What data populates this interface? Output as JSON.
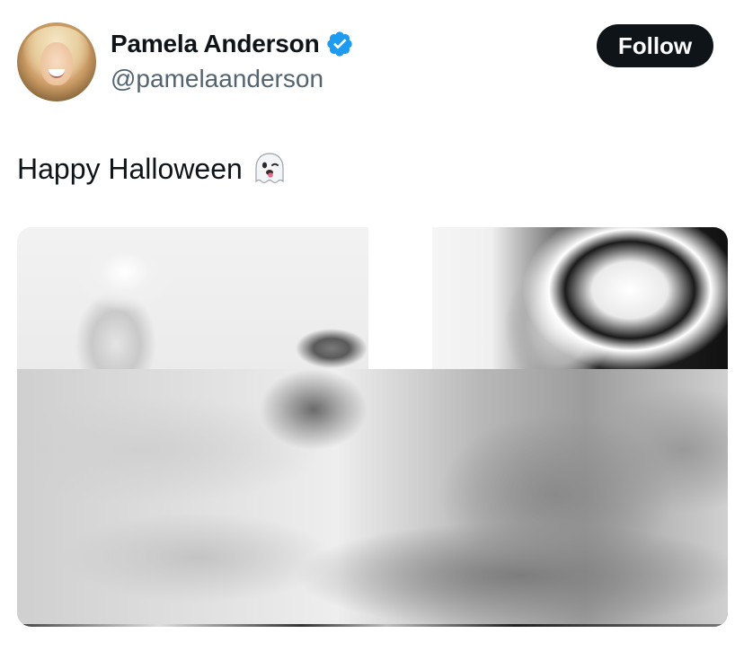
{
  "author": {
    "display_name": "Pamela Anderson",
    "handle": "@pamelaanderson",
    "verified": true,
    "avatar_icon": "avatar-photo",
    "verified_icon": "verified-badge-icon",
    "verified_color": "#1d9bf0"
  },
  "actions": {
    "follow_label": "Follow"
  },
  "tweet": {
    "text": "Happy Halloween",
    "emoji": "ghost-emoji"
  },
  "media": {
    "count": 2,
    "items": [
      {
        "kind": "photo",
        "tone": "black-and-white"
      },
      {
        "kind": "photo",
        "tone": "black-and-white"
      }
    ],
    "obscured": true
  },
  "colors": {
    "text_primary": "#0f1419",
    "text_secondary": "#536471",
    "button_bg": "#0f1419",
    "button_text": "#ffffff"
  }
}
